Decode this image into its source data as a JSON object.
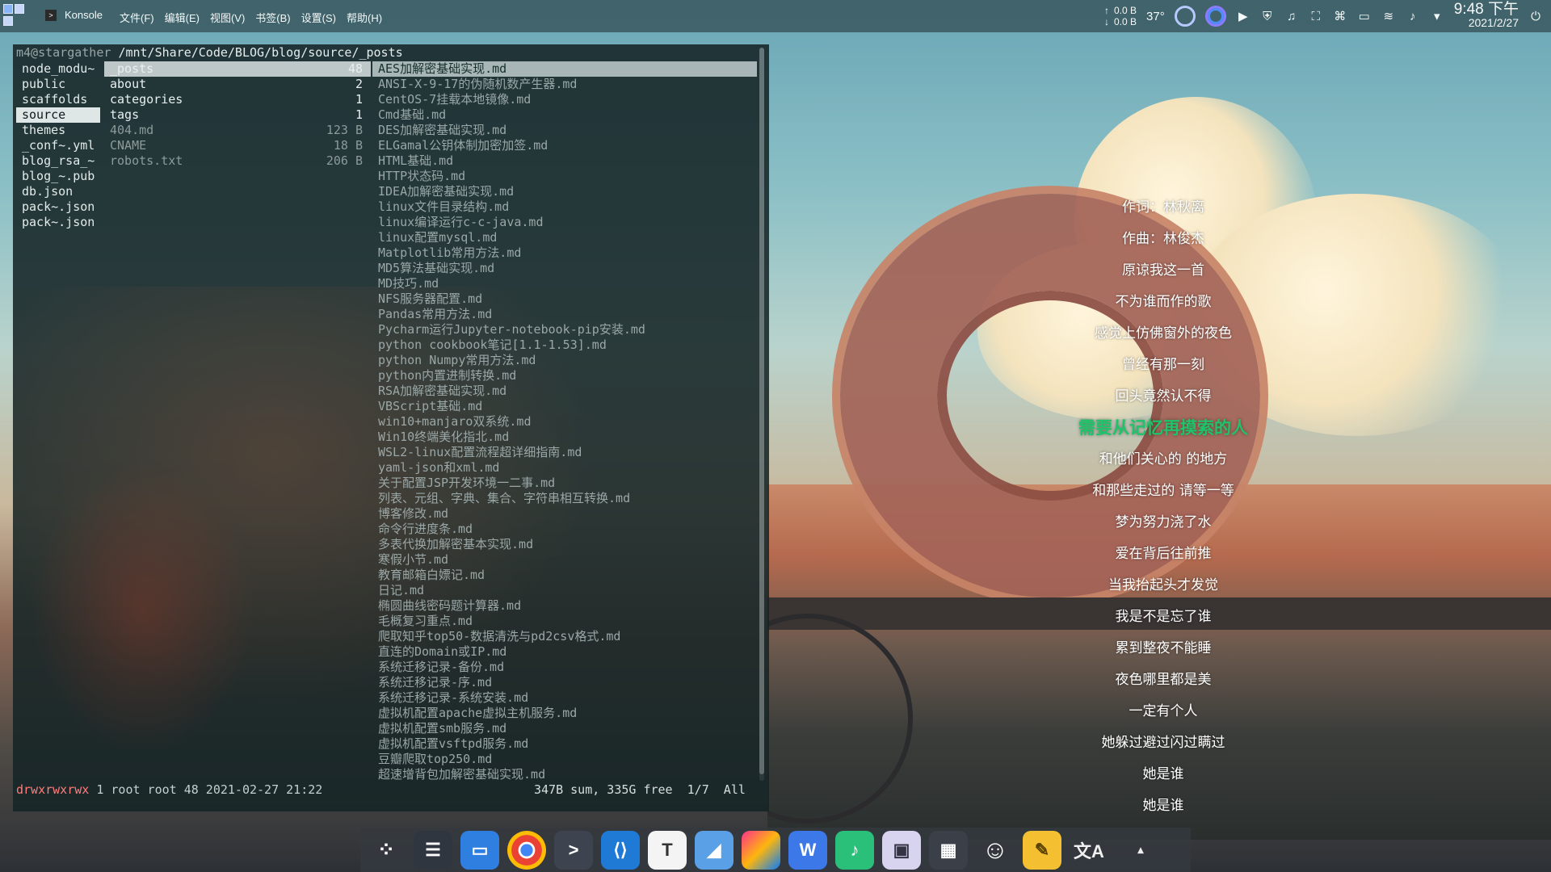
{
  "topbar": {
    "app_name": "Konsole",
    "menu": [
      "文件(F)",
      "编辑(E)",
      "视图(V)",
      "书签(B)",
      "设置(S)",
      "帮助(H)"
    ],
    "net_up": "0.0 B",
    "net_down": "0.0 B",
    "temperature": "37°",
    "time": "9:48 下午",
    "date": "2021/2/27",
    "tray_icons": [
      "play-icon",
      "shield-icon",
      "music-icon",
      "screenshot-icon",
      "keyboard-icon",
      "battery-icon",
      "wifi-icon",
      "volume-icon",
      "chevron-down-icon"
    ]
  },
  "terminal": {
    "prompt_host": "m4@stargather",
    "prompt_path": "/mnt/Share/Code/BLOG/blog/source/_posts",
    "parent_dir": [
      "node_modu~",
      "public",
      "scaffolds",
      "source",
      "themes",
      "_conf~.yml",
      "blog_rsa_~",
      "blog_~.pub",
      "db.json",
      "pack~.json",
      "pack~.json"
    ],
    "current_dir": [
      {
        "name": "_posts",
        "size": "48"
      },
      {
        "name": "about",
        "size": "2"
      },
      {
        "name": "categories",
        "size": "1"
      },
      {
        "name": "tags",
        "size": "1"
      },
      {
        "name": "404.md",
        "size": "123 B"
      },
      {
        "name": "CNAME",
        "size": "18 B"
      },
      {
        "name": "robots.txt",
        "size": "206 B"
      }
    ],
    "preview_files": [
      "AES加解密基础实现.md",
      "ANSI-X-9-17的伪随机数产生器.md",
      "CentOS-7挂载本地镜像.md",
      "Cmd基础.md",
      "DES加解密基础实现.md",
      "ELGamal公钥体制加密加签.md",
      "HTML基础.md",
      "HTTP状态码.md",
      "IDEA加解密基础实现.md",
      "linux文件目录结构.md",
      "linux编译运行c-c-java.md",
      "linux配置mysql.md",
      "Matplotlib常用方法.md",
      "MD5算法基础实现.md",
      "MD技巧.md",
      "NFS服务器配置.md",
      "Pandas常用方法.md",
      "Pycharm运行Jupyter-notebook-pip安装.md",
      "python cookbook笔记[1.1-1.53].md",
      "python Numpy常用方法.md",
      "python内置进制转换.md",
      "RSA加解密基础实现.md",
      "VBScript基础.md",
      "win10+manjaro双系统.md",
      "Win10终端美化指北.md",
      "WSL2-linux配置流程超详细指南.md",
      "yaml-json和xml.md",
      "关于配置JSP开发环境一二事.md",
      "列表、元组、字典、集合、字符串相互转换.md",
      "博客修改.md",
      "命令行进度条.md",
      "多表代换加解密基本实现.md",
      "寒假小节.md",
      "教育邮箱白嫖记.md",
      "日记.md",
      "椭圆曲线密码题计算器.md",
      "毛概复习重点.md",
      "爬取知乎top50-数据清洗与pd2csv格式.md",
      "直连的Domain或IP.md",
      "系统迁移记录-备份.md",
      "系统迁移记录-序.md",
      "系统迁移记录-系统安装.md",
      "虚拟机配置apache虚拟主机服务.md",
      "虚拟机配置smb服务.md",
      "虚拟机配置vsftpd服务.md",
      "豆瓣爬取top250.md",
      "超速增背包加解密基础实现.md"
    ],
    "status_perm": "drwxrwxrwx",
    "status_info": " 1 root root 48 2021-02-27 21:22",
    "status_right": "347B sum, 335G free  1/7  All"
  },
  "lyrics": [
    "作词：林秋离",
    "作曲：林俊杰",
    "原谅我这一首",
    "不为谁而作的歌",
    "感觉上仿佛窗外的夜色",
    "曾经有那一刻",
    "回头竟然认不得",
    "需要从记忆再摸索的人",
    "和他们关心的 的地方",
    "和那些走过的 请等一等",
    "梦为努力浇了水",
    "爱在背后往前推",
    "当我抬起头才发觉",
    "我是不是忘了谁",
    "累到整夜不能睡",
    "夜色哪里都是美",
    "一定有个人",
    "她躲过避过闪过瞒过",
    "她是谁",
    "她是谁"
  ],
  "lyrics_current_index": 7,
  "colors": {
    "lyric_current": "#1ec36a",
    "perm_text": "#ff7c7c",
    "panel_bg": "#3a5860"
  },
  "dock": [
    {
      "name": "app-launcher-icon",
      "glyph": "⁘"
    },
    {
      "name": "settings-icon",
      "glyph": "☰"
    },
    {
      "name": "file-manager-icon",
      "glyph": "▭"
    },
    {
      "name": "chrome-icon",
      "glyph": ""
    },
    {
      "name": "terminal-icon",
      "glyph": ">"
    },
    {
      "name": "vscode-icon",
      "glyph": "⟨⟩"
    },
    {
      "name": "typora-icon",
      "glyph": "T"
    },
    {
      "name": "drawing-icon",
      "glyph": "◢"
    },
    {
      "name": "jetbrains-icon",
      "glyph": ""
    },
    {
      "name": "wps-icon",
      "glyph": "W"
    },
    {
      "name": "music-player-icon",
      "glyph": "♪"
    },
    {
      "name": "disk-utility-icon",
      "glyph": "▣"
    },
    {
      "name": "calculator-icon",
      "glyph": "▦"
    },
    {
      "name": "emoji-icon",
      "glyph": "☺"
    },
    {
      "name": "notes-icon",
      "glyph": "✎"
    },
    {
      "name": "translate-icon",
      "glyph": "文A"
    },
    {
      "name": "tray-expand-icon",
      "glyph": "▴"
    }
  ]
}
